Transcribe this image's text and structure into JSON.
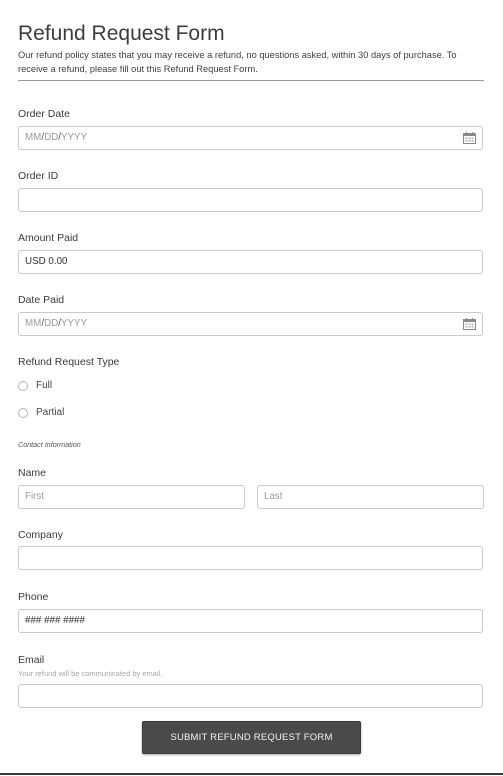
{
  "form": {
    "title": "Refund Request Form",
    "description": "Our refund policy states that you may receive a refund, no questions asked, within 30 days of purchase. To receive a refund, please fill out this Refund Request Form."
  },
  "order_date": {
    "label": "Order Date",
    "mm": "MM",
    "dd": "DD",
    "yyyy": "YYYY",
    "sep": "/"
  },
  "order_id": {
    "label": "Order ID",
    "value": ""
  },
  "amount_paid": {
    "label": "Amount Paid",
    "value": "USD  0.00"
  },
  "date_paid": {
    "label": "Date Paid",
    "mm": "MM",
    "dd": "DD",
    "yyyy": "YYYY",
    "sep": "/"
  },
  "refund_type": {
    "label": "Refund Request Type",
    "options": [
      "Full",
      "Partial"
    ]
  },
  "contact": {
    "section_label": "Contact Information"
  },
  "name": {
    "label": "Name",
    "first_placeholder": "First",
    "last_placeholder": "Last"
  },
  "company": {
    "label": "Company",
    "value": ""
  },
  "phone": {
    "label": "Phone",
    "placeholder": "### ### ####"
  },
  "email": {
    "label": "Email",
    "hint": "Your refund will be communicated by email.",
    "value": ""
  },
  "submit": {
    "label": "SUBMIT REFUND REQUEST FORM"
  },
  "icons": {
    "calendar": "calendar-icon"
  }
}
